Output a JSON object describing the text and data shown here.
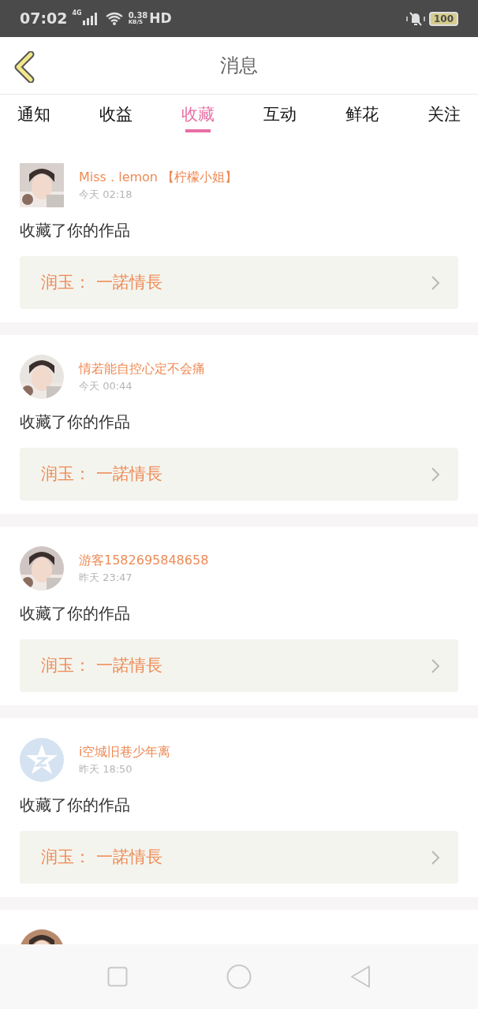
{
  "status_bar": {
    "time": "07:02",
    "network": "4G",
    "speed_value": "0.38",
    "speed_unit": "KB/S",
    "hd": "HD",
    "battery": "100"
  },
  "header": {
    "title": "消息"
  },
  "tabs": [
    {
      "label": "通知",
      "selected": false
    },
    {
      "label": "收益",
      "selected": false
    },
    {
      "label": "收藏",
      "selected": true
    },
    {
      "label": "互动",
      "selected": false
    },
    {
      "label": "鲜花",
      "selected": false
    },
    {
      "label": "关注",
      "selected": false
    }
  ],
  "messages": [
    {
      "avatar": {
        "kind": "square_picture"
      },
      "name": "Miss . lemon 【柠檬小姐】",
      "time": "今天 02:18",
      "action": "收藏了你的作品",
      "work": "润玉： 一諾情長"
    },
    {
      "avatar": {
        "kind": "picture"
      },
      "name": "情若能自控心定不会痛",
      "time": "今天 00:44",
      "action": "收藏了你的作品",
      "work": "润玉： 一諾情長"
    },
    {
      "avatar": {
        "kind": "picture"
      },
      "name": "游客1582695848658",
      "time": "昨天 23:47",
      "action": "收藏了你的作品",
      "work": "润玉： 一諾情長"
    },
    {
      "avatar": {
        "kind": "default"
      },
      "name": "i空城旧巷少年离",
      "time": "昨天 18:50",
      "action": "收藏了你的作品",
      "work": "润玉： 一諾情長"
    },
    {
      "avatar": {
        "kind": "picture"
      }
    }
  ]
}
